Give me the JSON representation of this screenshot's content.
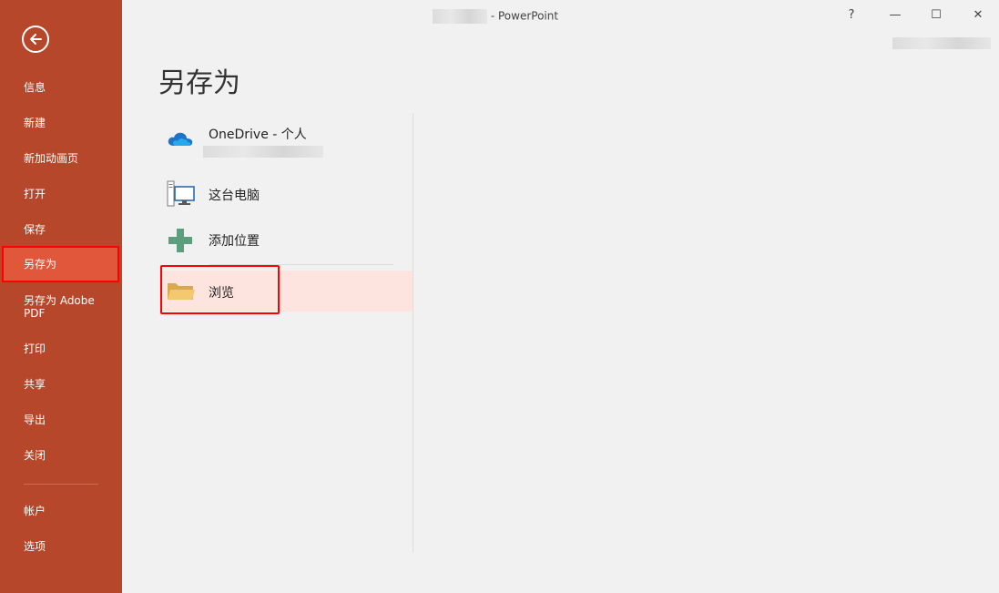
{
  "window": {
    "title_suffix": "- PowerPoint",
    "help_label": "?",
    "minimize_label": "—",
    "maximize_label": "☐",
    "close_label": "✕"
  },
  "sidebar": {
    "back_icon": "arrow-left-icon",
    "items": [
      {
        "label": "信息"
      },
      {
        "label": "新建"
      },
      {
        "label": "新加动画页"
      },
      {
        "label": "打开"
      },
      {
        "label": "保存"
      },
      {
        "label": "另存为",
        "selected": true
      },
      {
        "label": "另存为 Adobe PDF"
      },
      {
        "label": "打印"
      },
      {
        "label": "共享"
      },
      {
        "label": "导出"
      },
      {
        "label": "关闭"
      },
      {
        "label": "帐户"
      },
      {
        "label": "选项"
      }
    ]
  },
  "main": {
    "title": "另存为",
    "locations": [
      {
        "label": "OneDrive - 个人",
        "icon": "cloud-icon"
      },
      {
        "label": "这台电脑",
        "icon": "computer-icon"
      },
      {
        "label": "添加位置",
        "icon": "plus-icon"
      },
      {
        "label": "浏览",
        "icon": "folder-icon"
      }
    ]
  },
  "colors": {
    "sidebar_bg": "#b7472a",
    "selected_bg": "#e0573c",
    "highlight_border": "#ff0000",
    "browse_bg": "#fde4de"
  }
}
